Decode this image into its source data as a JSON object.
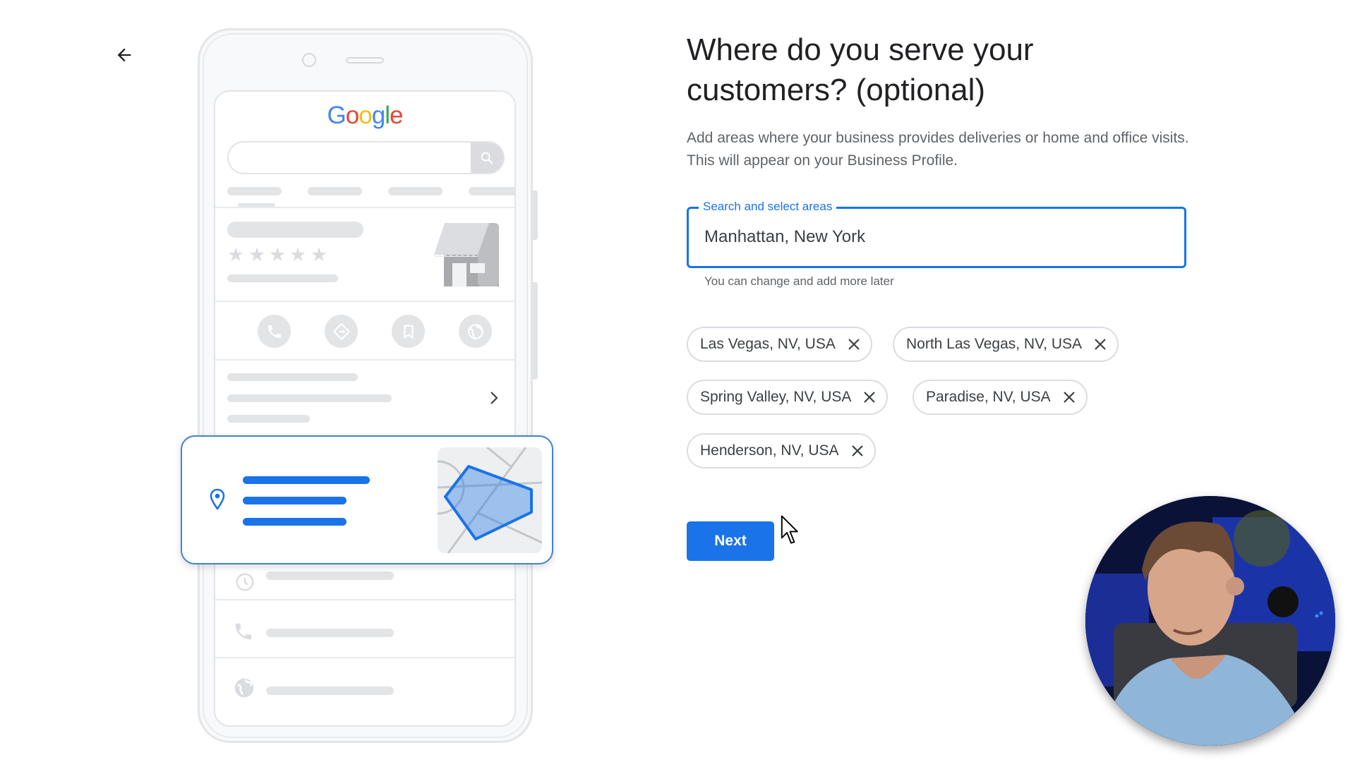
{
  "nav": {
    "back_icon": "arrow-left-icon"
  },
  "illustration": {
    "logo_letters": [
      {
        "char": "G",
        "color": "#4285f4"
      },
      {
        "char": "o",
        "color": "#ea4335"
      },
      {
        "char": "o",
        "color": "#fbbc05"
      },
      {
        "char": "g",
        "color": "#4285f4"
      },
      {
        "char": "l",
        "color": "#34a853"
      },
      {
        "char": "e",
        "color": "#ea4335"
      }
    ],
    "rating_stars": 5,
    "action_icons": [
      "phone-icon",
      "directions-icon",
      "bookmark-icon",
      "globe-icon"
    ],
    "accent_color": "#1a73e8"
  },
  "form": {
    "title": "Where do you serve your customers? (optional)",
    "description": "Add areas where your business provides deliveries or home and office visits. This will appear on your Business Profile.",
    "search_field": {
      "label": "Search and select areas",
      "value": "Manhattan, New York",
      "helper": "You can change and add more later"
    },
    "selected_areas": [
      "Las Vegas, NV, USA",
      "North Las Vegas, NV, USA",
      "Spring Valley, NV, USA",
      "Paradise, NV, USA",
      "Henderson, NV, USA"
    ],
    "next_label": "Next"
  },
  "colors": {
    "primary": "#1a73e8",
    "text": "#202124",
    "secondary_text": "#5f6368",
    "chip_border": "#dadce0"
  }
}
